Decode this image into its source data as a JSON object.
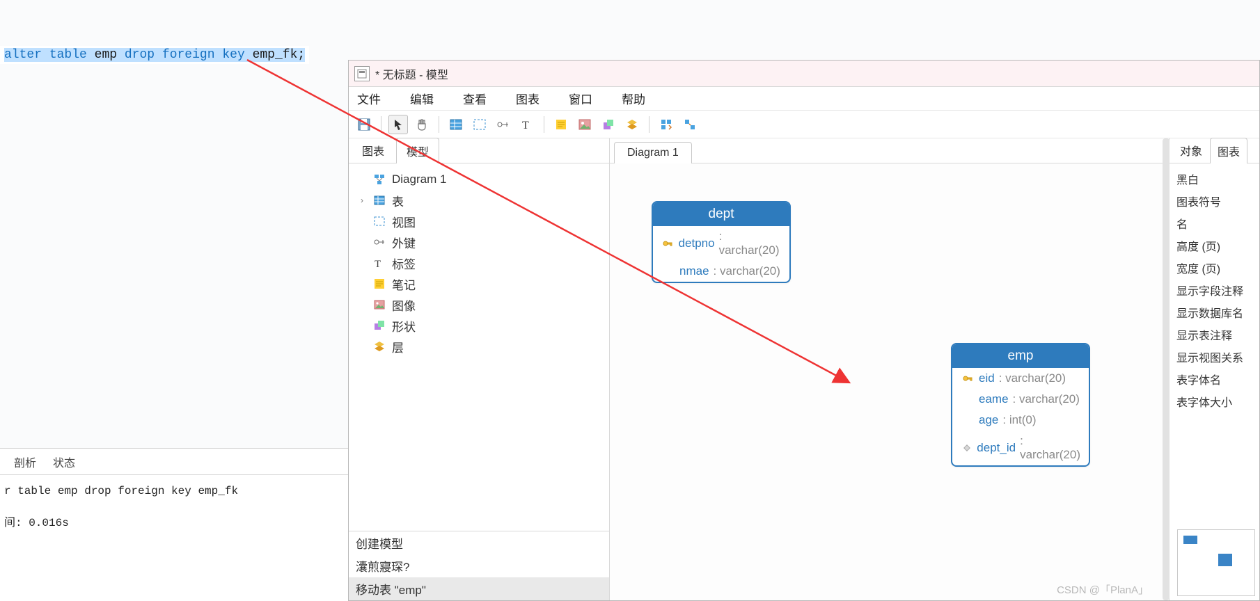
{
  "sql_editor": {
    "line": {
      "tokens": [
        {
          "t": "alter",
          "cls": "kw"
        },
        {
          "t": " ",
          "cls": "sp"
        },
        {
          "t": "table",
          "cls": "kw"
        },
        {
          "t": " ",
          "cls": "sp"
        },
        {
          "t": "emp",
          "cls": "tok"
        },
        {
          "t": " ",
          "cls": "sp"
        },
        {
          "t": "drop",
          "cls": "kw"
        },
        {
          "t": " ",
          "cls": "sp"
        },
        {
          "t": "foreign",
          "cls": "kw"
        },
        {
          "t": " ",
          "cls": "sp"
        },
        {
          "t": "key",
          "cls": "kw"
        },
        {
          "t": " ",
          "cls": "sp"
        },
        {
          "t": "emp_fk;",
          "cls": "tok"
        }
      ]
    }
  },
  "console": {
    "tabs": {
      "profile": "剖析",
      "state": "状态"
    },
    "log1": "r table emp drop foreign key emp_fk",
    "log2": "间: 0.016s"
  },
  "modeler": {
    "title": "* 无标题 - 模型",
    "menu": {
      "file": "文件",
      "edit": "编辑",
      "view": "查看",
      "diagram": "图表",
      "window": "窗口",
      "help": "帮助"
    },
    "left_tabs": {
      "diagram": "图表",
      "model": "模型"
    },
    "tree": [
      {
        "icon": "diagram",
        "label": "Diagram 1",
        "exp": ""
      },
      {
        "icon": "table",
        "label": "表",
        "exp": "›"
      },
      {
        "icon": "view",
        "label": "视图",
        "exp": ""
      },
      {
        "icon": "fk",
        "label": "外键",
        "exp": ""
      },
      {
        "icon": "label",
        "label": "标签",
        "exp": ""
      },
      {
        "icon": "note",
        "label": "笔记",
        "exp": ""
      },
      {
        "icon": "image",
        "label": "图像",
        "exp": ""
      },
      {
        "icon": "shape",
        "label": "形状",
        "exp": ""
      },
      {
        "icon": "layer",
        "label": "层",
        "exp": ""
      }
    ],
    "log": [
      {
        "text": "创建模型",
        "sel": false
      },
      {
        "text": "灢煎寢琛?",
        "sel": false
      },
      {
        "text": "移动表 \"emp\"",
        "sel": true
      }
    ],
    "canvas": {
      "tab": "Diagram 1",
      "dept": {
        "title": "dept",
        "cols": [
          {
            "pk": true,
            "name": "detpno",
            "type": "varchar(20)"
          },
          {
            "pk": false,
            "name": "nmae",
            "type": "varchar(20)"
          }
        ]
      },
      "emp": {
        "title": "emp",
        "cols": [
          {
            "pk": true,
            "name": "eid",
            "type": "varchar(20)"
          },
          {
            "pk": false,
            "name": "eame",
            "type": "varchar(20)"
          },
          {
            "pk": false,
            "name": "age",
            "type": "int(0)"
          },
          {
            "pk": false,
            "diamond": true,
            "name": "dept_id",
            "type": "varchar(20)"
          }
        ]
      }
    },
    "right": {
      "tabs": {
        "object": "对象",
        "diagram": "图表"
      },
      "items": [
        "黑白",
        "图表符号",
        "名",
        "高度 (页)",
        "宽度 (页)",
        "显示字段注释",
        "显示数据库名",
        "显示表注释",
        "显示视图关系",
        "表字体名",
        "表字体大小"
      ]
    }
  },
  "watermark": {
    "left": "CSDN @「PlanA」",
    "right": ""
  }
}
